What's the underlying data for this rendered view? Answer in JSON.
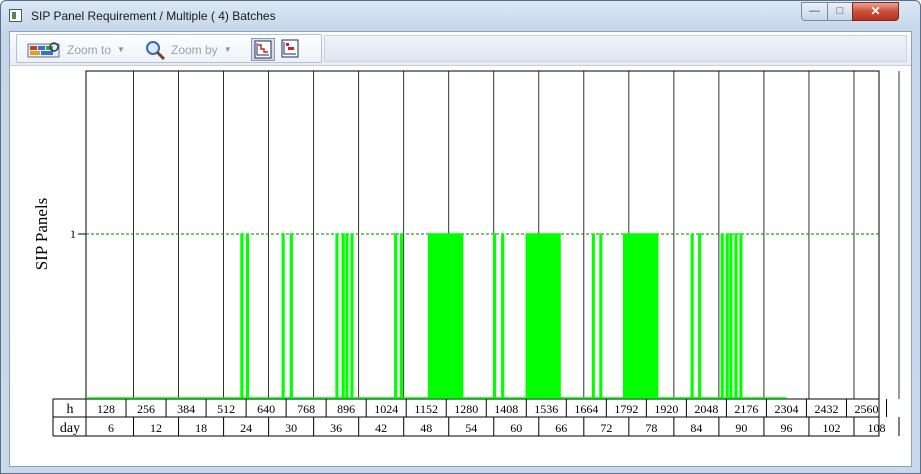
{
  "window": {
    "title": "SIP Panel Requirement / Multiple ( 4) Batches",
    "minimize_glyph": "—",
    "maximize_glyph": "□",
    "close_glyph": "✕"
  },
  "toolbar": {
    "zoom_to_label": "Zoom to",
    "zoom_by_label": "Zoom by",
    "dropdown_glyph": "▼",
    "icons": [
      "zoom-to-icon",
      "magnifier-icon",
      "step-chart-icon",
      "bar-chart-icon"
    ]
  },
  "chart_data": {
    "type": "step",
    "ylabel": "SIP Panels",
    "y_tick_labels": [
      "1"
    ],
    "ylim": [
      0,
      1
    ],
    "xlim": [
      64,
      2600
    ],
    "series_color": "#00ff00",
    "reference_line": {
      "y": 1,
      "style": "dashed",
      "color": "#008000"
    },
    "h_axis": {
      "label": "h",
      "ticks": [
        "128",
        "256",
        "384",
        "512",
        "640",
        "768",
        "896",
        "1024",
        "1152",
        "1280",
        "1408",
        "1536",
        "1664",
        "1792",
        "1920",
        "2048",
        "2176",
        "2304",
        "2432",
        "2560"
      ]
    },
    "day_axis": {
      "label": "day",
      "ticks": [
        "6",
        "12",
        "18",
        "24",
        "30",
        "36",
        "42",
        "48",
        "54",
        "60",
        "66",
        "72",
        "78",
        "84",
        "90",
        "96",
        "102",
        "108"
      ]
    },
    "pulses": [
      [
        560,
        565
      ],
      [
        578,
        583
      ],
      [
        692,
        697
      ],
      [
        718,
        723
      ],
      [
        864,
        869
      ],
      [
        884,
        889
      ],
      [
        896,
        901
      ],
      [
        912,
        917
      ],
      [
        1052,
        1057
      ],
      [
        1070,
        1075
      ],
      [
        1160,
        1163
      ],
      [
        1167,
        1170
      ],
      [
        1174,
        1177
      ],
      [
        1181,
        1184
      ],
      [
        1188,
        1191
      ],
      [
        1195,
        1198
      ],
      [
        1202,
        1205
      ],
      [
        1209,
        1212
      ],
      [
        1216,
        1219
      ],
      [
        1223,
        1226
      ],
      [
        1230,
        1233
      ],
      [
        1237,
        1240
      ],
      [
        1244,
        1247
      ],
      [
        1251,
        1254
      ],
      [
        1258,
        1261
      ],
      [
        1265,
        1268
      ],
      [
        1368,
        1373
      ],
      [
        1394,
        1399
      ],
      [
        1472,
        1475
      ],
      [
        1479,
        1482
      ],
      [
        1486,
        1489
      ],
      [
        1493,
        1496
      ],
      [
        1500,
        1503
      ],
      [
        1507,
        1510
      ],
      [
        1514,
        1517
      ],
      [
        1521,
        1524
      ],
      [
        1528,
        1531
      ],
      [
        1535,
        1538
      ],
      [
        1542,
        1545
      ],
      [
        1549,
        1552
      ],
      [
        1556,
        1559
      ],
      [
        1563,
        1566
      ],
      [
        1570,
        1573
      ],
      [
        1577,
        1580
      ],
      [
        1684,
        1689
      ],
      [
        1708,
        1713
      ],
      [
        1784,
        1787
      ],
      [
        1791,
        1794
      ],
      [
        1798,
        1801
      ],
      [
        1805,
        1808
      ],
      [
        1812,
        1815
      ],
      [
        1819,
        1822
      ],
      [
        1826,
        1829
      ],
      [
        1833,
        1836
      ],
      [
        1840,
        1843
      ],
      [
        1847,
        1850
      ],
      [
        1854,
        1857
      ],
      [
        1861,
        1864
      ],
      [
        1868,
        1871
      ],
      [
        1875,
        1878
      ],
      [
        1882,
        1885
      ],
      [
        1889,
        1892
      ],
      [
        2000,
        2005
      ],
      [
        2024,
        2029
      ],
      [
        2096,
        2101
      ],
      [
        2112,
        2117
      ],
      [
        2124,
        2129
      ],
      [
        2140,
        2145
      ],
      [
        2156,
        2161
      ]
    ]
  }
}
